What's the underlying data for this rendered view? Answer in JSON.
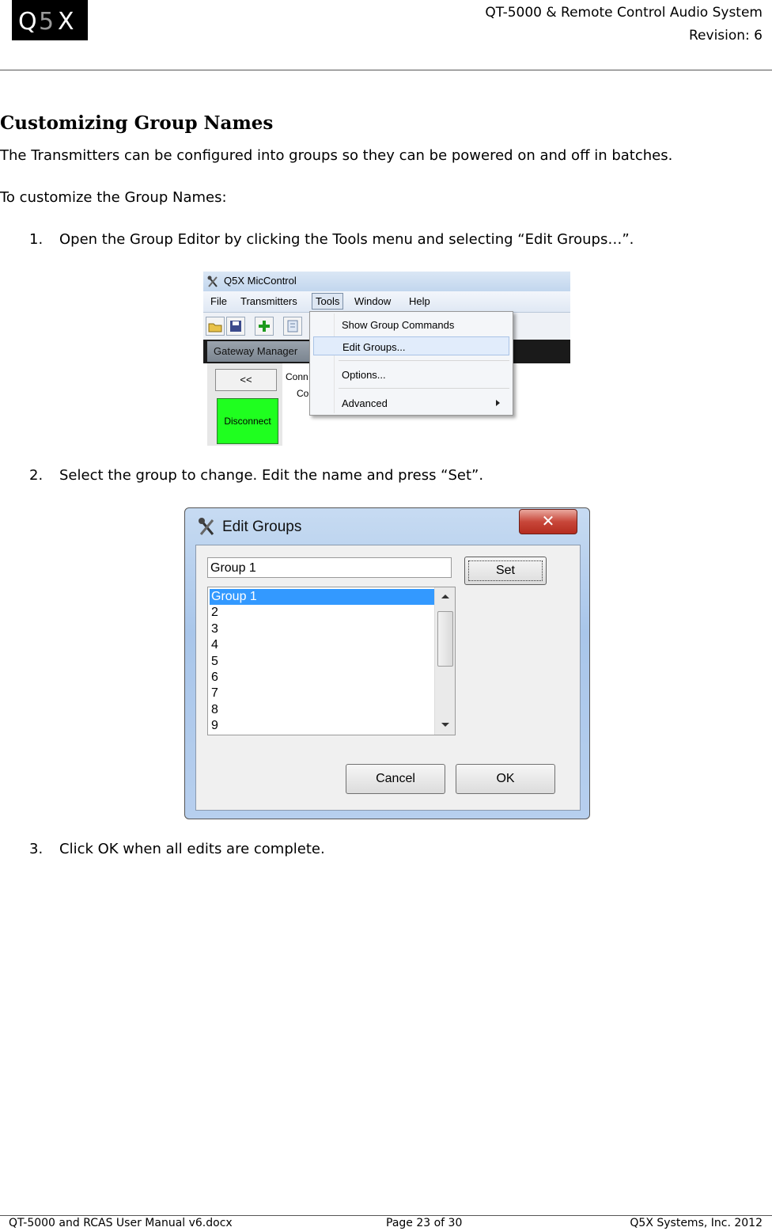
{
  "header": {
    "logo_text": "Q5X",
    "line1": "QT-5000 & Remote Control Audio System",
    "line2": "Revision: 6"
  },
  "section": {
    "title": "Customizing Group Names",
    "intro": "The Transmitters can be configured into groups so they can be powered on and off in batches.",
    "lead": "To customize the Group Names:",
    "steps": [
      {
        "num": "1.",
        "text": "Open the Group Editor by clicking the Tools menu and selecting “Edit Groups…”."
      },
      {
        "num": "2.",
        "text": "Select the group to change. Edit the name and press “Set”."
      },
      {
        "num": "3.",
        "text": "Click OK when all edits are complete."
      }
    ]
  },
  "screenshot1": {
    "window_title": "Q5X MicControl",
    "menus": [
      "File",
      "Transmitters",
      "Tools",
      "Window",
      "Help"
    ],
    "active_menu": "Tools",
    "panel_title": "Gateway Manager",
    "back_button": "<<",
    "disconnect_button": "Disconnect",
    "conn_label": "Conn",
    "co_label": "Co",
    "dropdown": {
      "items": [
        "Show Group Commands",
        "Edit Groups...",
        "Options...",
        "Advanced"
      ],
      "highlighted": "Edit Groups..."
    }
  },
  "screenshot2": {
    "dialog_title": "Edit Groups",
    "name_value": "Group 1",
    "set_button": "Set",
    "list_items": [
      "Group 1",
      "2",
      "3",
      "4",
      "5",
      "6",
      "7",
      "8",
      "9"
    ],
    "selected_item": "Group 1",
    "cancel_button": "Cancel",
    "ok_button": "OK",
    "close_glyph": "✕"
  },
  "footer": {
    "left": "QT-5000 and RCAS User Manual v6.docx",
    "center": "Page 23 of 30",
    "right": "Q5X Systems, Inc. 2012"
  }
}
